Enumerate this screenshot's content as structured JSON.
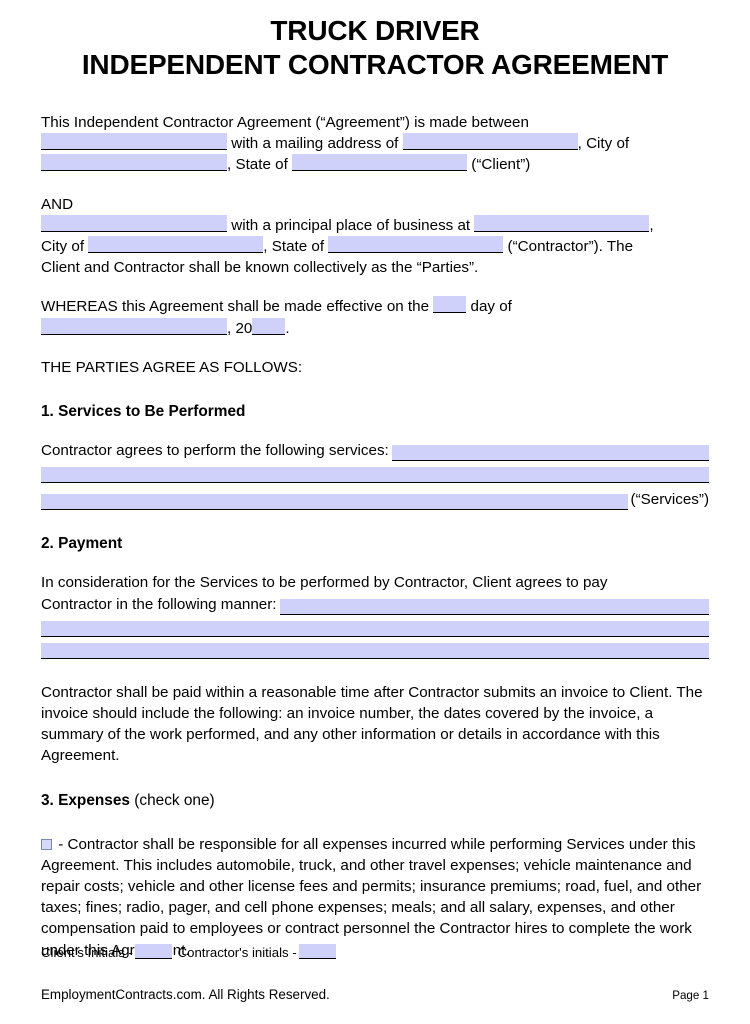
{
  "document": {
    "title_line1": "TRUCK DRIVER",
    "title_line2": "INDEPENDENT CONTRACTOR AGREEMENT"
  },
  "intro": {
    "lead": "This Independent Contractor Agreement (“Agreement”) is made between",
    "mailing_label": "with a mailing address of",
    "city_label": ", City of",
    "state_label": ", State of",
    "client_label": "(“Client”)"
  },
  "and_block": {
    "and": "AND",
    "business_label": "with a principal place of business at",
    "comma": ",",
    "city_label": "City of",
    "state_label": ", State of",
    "contractor_label": "(“Contractor”). The",
    "parties_line": "Client and Contractor shall be known collectively as the “Parties”."
  },
  "whereas": {
    "text_before": "WHEREAS this Agreement shall be made effective on the",
    "text_after": "day of",
    "year_prefix": ", 20",
    "period": "."
  },
  "agree_header": "THE PARTIES AGREE AS FOLLOWS:",
  "sections": {
    "services": {
      "number_title": "1. Services to Be Performed",
      "lead": "Contractor agrees to perform the following services:",
      "trail": "(“Services”)"
    },
    "payment": {
      "number_title": "2. Payment",
      "lead_line1": "In consideration for the Services to be performed by Contractor, Client agrees to pay",
      "lead_line2": "Contractor in the following manner:",
      "invoice_paragraph": "Contractor shall be paid within a reasonable time after Contractor submits an invoice to Client. The invoice should include the following: an invoice number, the dates covered by the invoice, a summary of the work performed, and any other information or details in accordance with this Agreement."
    },
    "expenses": {
      "number_title": "3. Expenses",
      "title_suffix": "(check one)",
      "option_text": "- Contractor shall be responsible for all expenses incurred while performing Services under this Agreement. This includes automobile, truck, and other travel expenses; vehicle maintenance and repair costs; vehicle and other license fees and permits; insurance premiums; road, fuel, and other taxes; fines; radio, pager, and cell phone expenses; meals; and all salary, expenses, and other compensation paid to employees or contract personnel the Contractor hires to complete the work under this Agreement."
    }
  },
  "footer": {
    "client_initials_label": "Client's Initials -",
    "contractor_initials_label": "Contractor's initials -",
    "copyright": "EmploymentContracts.com. All Rights Reserved.",
    "page_number": "Page 1"
  },
  "colors": {
    "field_fill": "#cfd1fa",
    "checkbox_border": "#7d86b8",
    "text": "#000000",
    "background": "#ffffff"
  }
}
